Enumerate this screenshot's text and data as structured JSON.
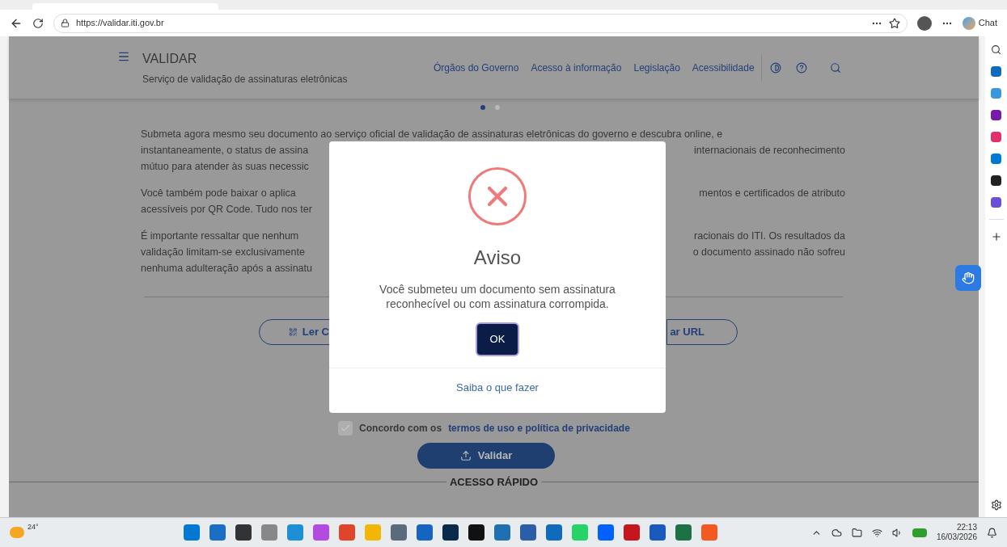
{
  "browser": {
    "url": "https://validar.iti.gov.br",
    "copilot_label": "Chat"
  },
  "site_header": {
    "title": "VALIDAR",
    "subtitle": "Serviço de validação de assinaturas eletrônicas",
    "nav": [
      "Órgãos do Governo",
      "Acesso à informação",
      "Legislação",
      "Acessibilidade"
    ]
  },
  "carousel_dots": [
    {
      "selected": true
    },
    {
      "selected": false
    }
  ],
  "paragraphs": [
    {
      "lines": [
        {
          "left": "Submeta agora mesmo seu documento ao serviço oficial de validação de assinaturas eletrônicas do governo e descubra online, e"
        },
        {
          "left": "instantaneamente, o status de assina",
          "right": "internacionais de reconhecimento"
        },
        {
          "left": "mútuo para atender às suas necessic"
        }
      ]
    },
    {
      "lines": [
        {
          "left": "Você também pode baixar o aplica",
          "right": "mentos e certificados de atributo"
        },
        {
          "left": "acessíveis por QR Code. Tudo nos ter"
        }
      ]
    },
    {
      "lines": [
        {
          "left": "É importante ressaltar que nenhum",
          "right": "racionais do ITI. Os resultados da"
        },
        {
          "left": "validação limitam-se exclusivamente",
          "right": "o documento assinado não sofreu"
        },
        {
          "left": "nenhuma adulteração após a assinatu"
        }
      ]
    }
  ],
  "action_buttons": [
    {
      "label": "Ler C",
      "kind": "qr"
    },
    {
      "label": "ar URL",
      "kind": "plain"
    }
  ],
  "consent": {
    "checked": true,
    "text": "Concordo com os",
    "link": "termos de uso e política de privacidade"
  },
  "validate_button": "Validar",
  "quick_access_title": "ACESSO RÁPIDO",
  "dialog": {
    "title": "Aviso",
    "message": "Você submeteu um documento sem assinatura reconhecível ou com assinatura corrompida.",
    "ok": "OK",
    "link": "Saiba o que fazer"
  },
  "taskbar": {
    "weather": "24°",
    "time": "22:13",
    "date": "16/03/2026"
  }
}
